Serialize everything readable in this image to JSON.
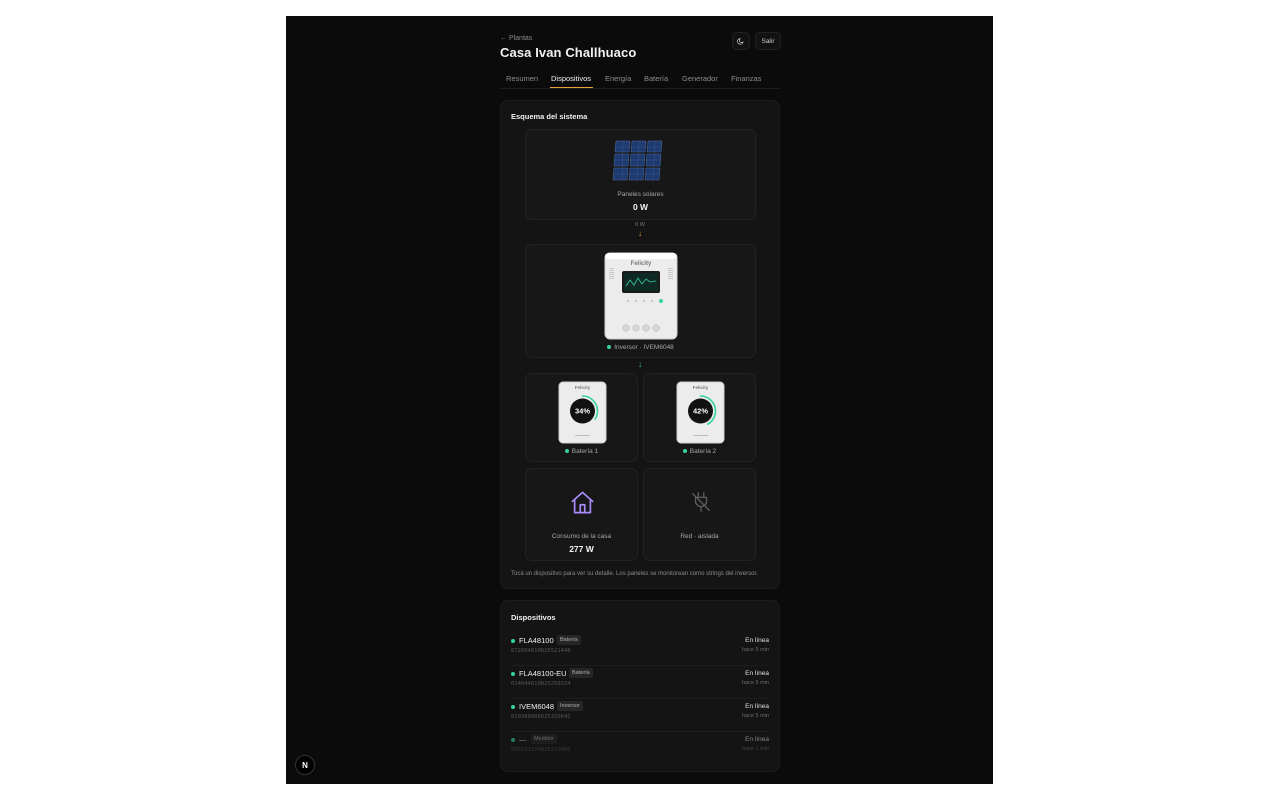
{
  "header": {
    "back_link": "← Plantas",
    "title": "Casa Ivan Challhuaco",
    "logout_label": "Salir",
    "theme_icon": "moon-icon"
  },
  "tabs": [
    {
      "label": "Resumen",
      "active": false
    },
    {
      "label": "Dispositivos",
      "active": true
    },
    {
      "label": "Energía",
      "active": false
    },
    {
      "label": "Batería",
      "active": false
    },
    {
      "label": "Generador",
      "active": false
    },
    {
      "label": "Finanzas",
      "active": false
    }
  ],
  "schema": {
    "title": "Esquema del sistema",
    "solar": {
      "label": "Paneles solares",
      "value": "0 W",
      "flow_label": "0 W"
    },
    "inverter": {
      "brand": "Felicity",
      "label": "Inversor · IVEM6048"
    },
    "batteries": [
      {
        "brand": "Felicity",
        "percent": "34%",
        "label": "Batería 1",
        "level": 0.34
      },
      {
        "brand": "Felicity",
        "percent": "42%",
        "label": "Batería 2",
        "level": 0.42
      }
    ],
    "house": {
      "label": "Consumo de la casa",
      "value": "277 W"
    },
    "grid": {
      "label": "Red · aislada"
    },
    "hint": "Tocá un dispositivo para ver su detalle. Los paneles se monitorean como strings del inversor.",
    "colors": {
      "accent": "#e6a23c",
      "online": "#34d399",
      "house": "#a78bfa"
    }
  },
  "devices": {
    "title": "Dispositivos",
    "items": [
      {
        "name": "FLA48100",
        "type": "Batería",
        "serial": "072604610825521448",
        "status": "En línea",
        "time": "hace 5 min"
      },
      {
        "name": "FLA48100-EU",
        "type": "Batería",
        "serial": "014044610825250324",
        "status": "En línea",
        "time": "hace 5 min"
      },
      {
        "name": "IVEM6048",
        "type": "Inversor",
        "serial": "020380000025320642",
        "status": "En línea",
        "time": "hace 5 min"
      },
      {
        "name": "—",
        "type": "Medidor",
        "serial": "000101270025210060",
        "status": "En línea",
        "time": "hace 1 min"
      }
    ]
  },
  "footer": {
    "badge": "N"
  }
}
